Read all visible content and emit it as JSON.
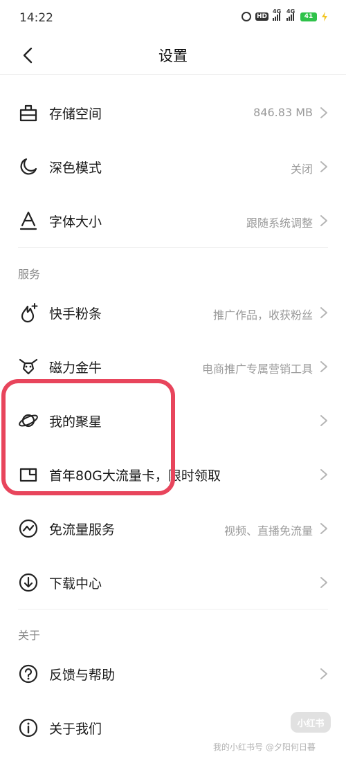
{
  "status_bar": {
    "time": "14:22",
    "hd_label": "HD",
    "net1": "4G",
    "net2": "4G",
    "battery": "41"
  },
  "header": {
    "title": "设置"
  },
  "general": [
    {
      "icon": "storage-icon",
      "label": "存储空间",
      "value": "846.83 MB"
    },
    {
      "icon": "moon-icon",
      "label": "深色模式",
      "value": "关闭"
    },
    {
      "icon": "font-size-icon",
      "label": "字体大小",
      "value": "跟随系统调整"
    }
  ],
  "services": {
    "title": "服务",
    "items": [
      {
        "icon": "fire-plus-icon",
        "label": "快手粉条",
        "value": "推广作品，收获粉丝"
      },
      {
        "icon": "bull-icon",
        "label": "磁力金牛",
        "value": "电商推广专属营销工具"
      },
      {
        "icon": "planet-icon",
        "label": "我的聚星",
        "value": ""
      },
      {
        "icon": "sim-card-icon",
        "label": "首年80G大流量卡，限时领取",
        "value": ""
      },
      {
        "icon": "free-data-icon",
        "label": "免流量服务",
        "value": "视频、直播免流量"
      },
      {
        "icon": "download-icon",
        "label": "下载中心",
        "value": ""
      }
    ]
  },
  "about": {
    "title": "关于",
    "items": [
      {
        "icon": "help-icon",
        "label": "反馈与帮助",
        "value": ""
      },
      {
        "icon": "info-icon",
        "label": "关于我们",
        "value": ""
      }
    ]
  },
  "watermark": {
    "badge": "小红书",
    "text": "我的小红书号 @夕阳何日暮"
  },
  "colors": {
    "highlight": "#e8455c",
    "battery": "#2fc24a",
    "muted": "#9a9a9a"
  }
}
